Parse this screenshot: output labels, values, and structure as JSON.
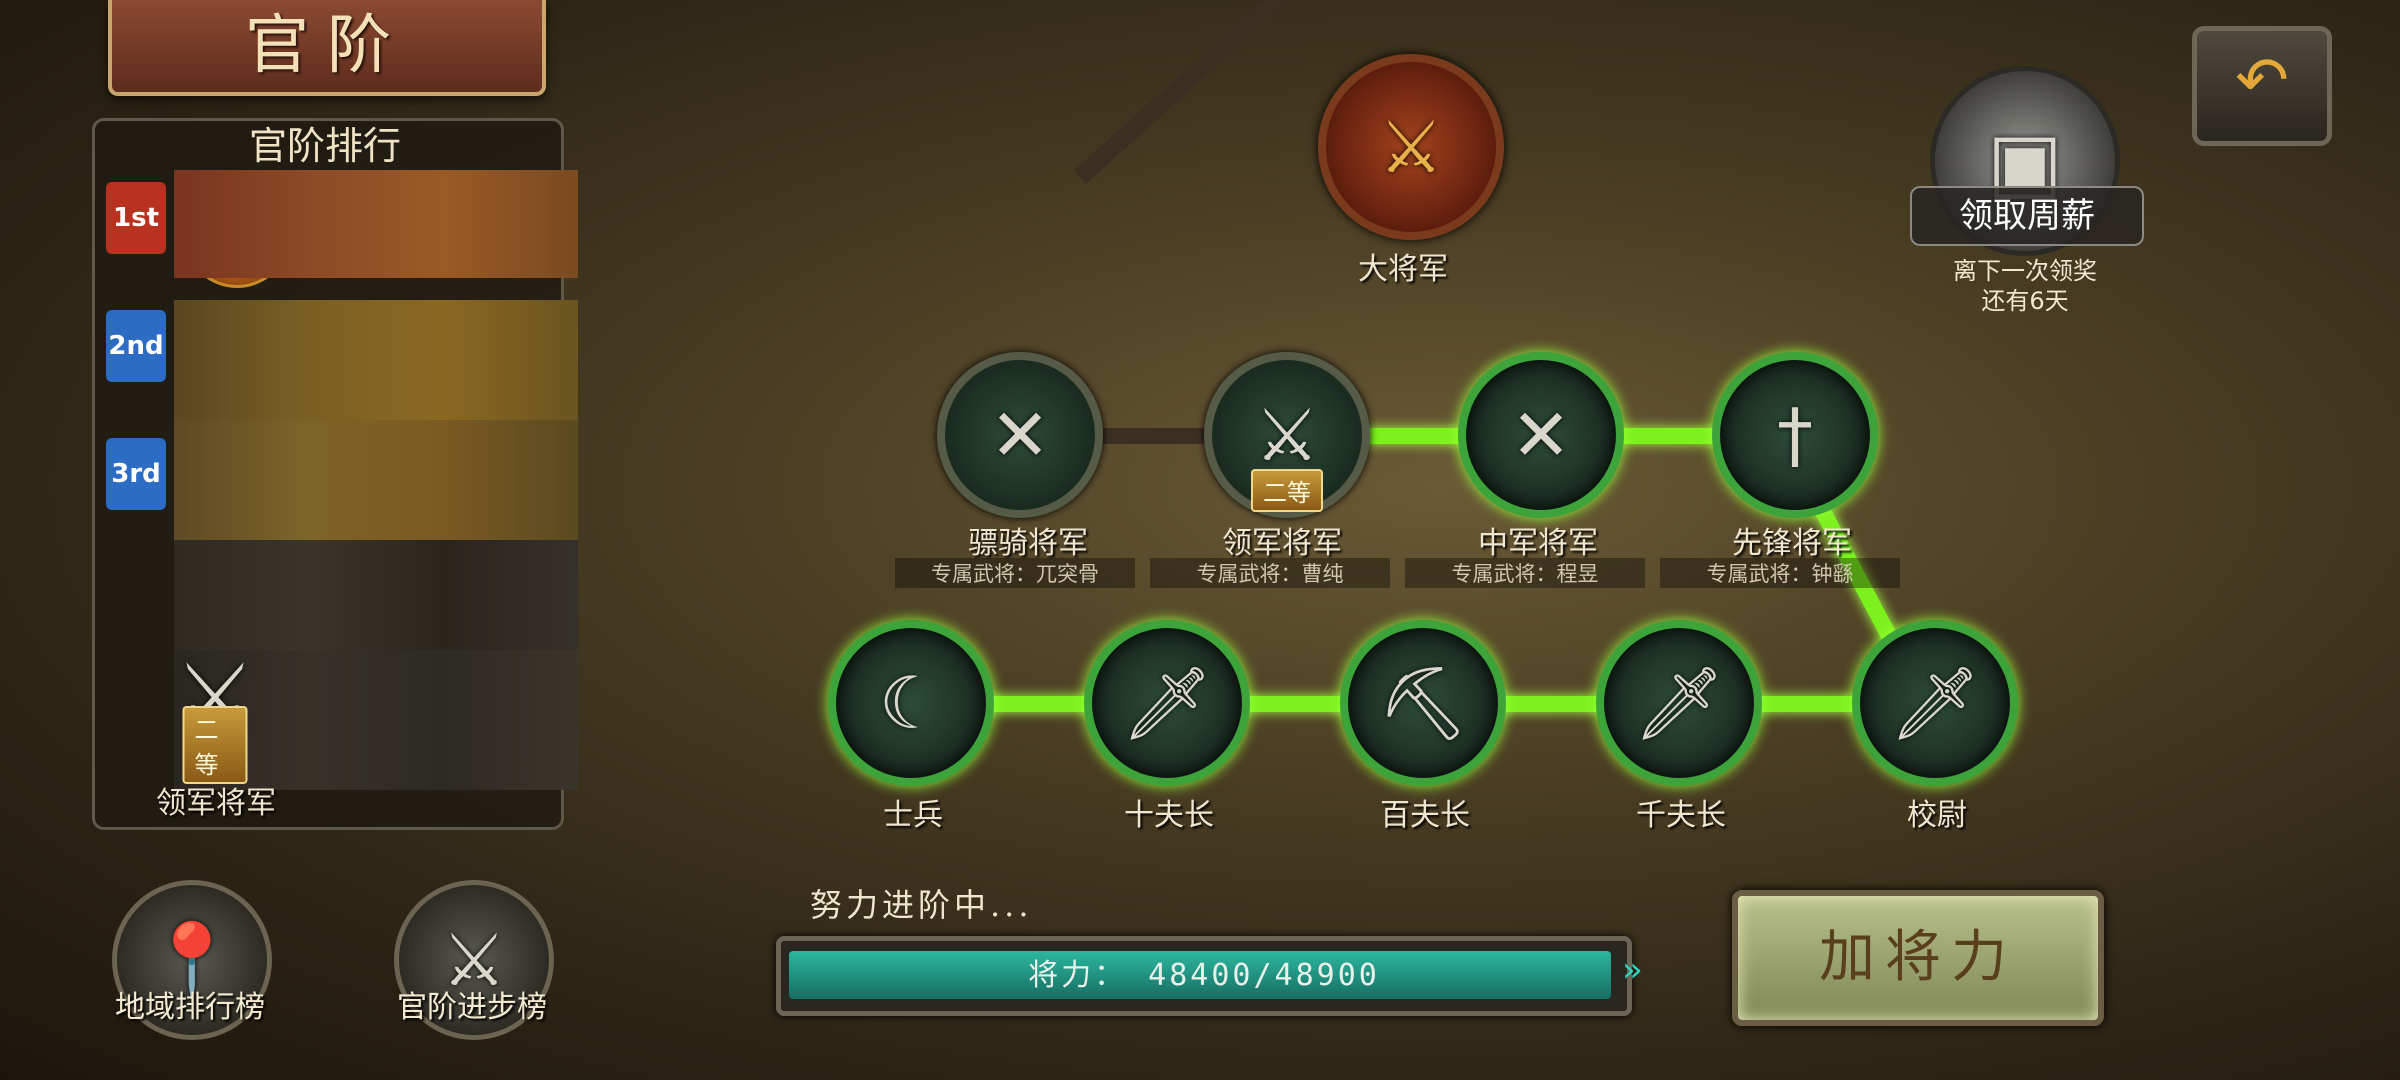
{
  "title": "官阶",
  "ranking": {
    "header": "官阶排行",
    "rows": [
      {
        "medal": "1st",
        "medal_color": "#b8321f"
      },
      {
        "medal": "2nd",
        "medal_color": "#2d6cc4"
      },
      {
        "medal": "3rd",
        "medal_color": "#2d6cc4"
      }
    ],
    "my_rank": {
      "grade": "二等",
      "name": "领军将军"
    }
  },
  "bottom_left": {
    "region_rank": "地域排行榜",
    "progress_rank": "官阶进步榜"
  },
  "tree": {
    "top": {
      "name": "大将军"
    },
    "generals": [
      {
        "name": "骠骑将军",
        "exclusive": "专属武将：兀突骨"
      },
      {
        "name": "领军将军",
        "exclusive": "专属武将：曹纯",
        "grade": "二等"
      },
      {
        "name": "中军将军",
        "exclusive": "专属武将：程昱"
      },
      {
        "name": "先锋将军",
        "exclusive": "专属武将：钟繇"
      }
    ],
    "ranks": [
      {
        "name": "士兵"
      },
      {
        "name": "十夫长"
      },
      {
        "name": "百夫长"
      },
      {
        "name": "千夫长"
      },
      {
        "name": "校尉"
      }
    ]
  },
  "progress": {
    "label": "努力进阶中...",
    "text": "将力： 48400/48900",
    "current": 48400,
    "max": 48900
  },
  "add_button": "加将力",
  "weekly": {
    "label": "领取周薪",
    "sub1": "离下一次领奖",
    "sub2": "还有6天"
  },
  "back_icon": "back-arrow-icon",
  "colors": {
    "link": "#7bf21c",
    "accent": "#3ca43a"
  }
}
